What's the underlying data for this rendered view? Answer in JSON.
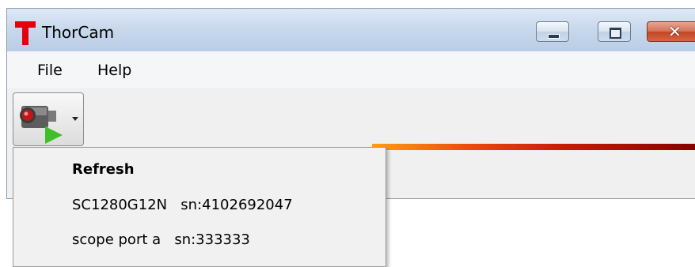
{
  "window": {
    "title": "ThorCam",
    "app_icon": "thorcam-t-icon",
    "controls": {
      "minimize_icon": "minimize-icon",
      "maximize_icon": "maximize-icon",
      "close_icon": "close-icon",
      "close_glyph": "✕"
    }
  },
  "menubar": {
    "items": [
      {
        "label": "File"
      },
      {
        "label": "Help"
      }
    ]
  },
  "toolbar": {
    "camera_button_icon": "camera-play-icon",
    "dropdown_icon": "chevron-down-icon"
  },
  "dropdown": {
    "items": [
      {
        "label": "Refresh"
      },
      {
        "label": "SC1280G12N   sn:4102692047"
      },
      {
        "label": "scope port a   sn:333333"
      }
    ]
  },
  "colors": {
    "brand_red": "#e3000f",
    "close_red": "#c34525",
    "play_green": "#3fbf2a",
    "color_bar_start": "#ff9f10",
    "color_bar_end": "#8a0000"
  }
}
